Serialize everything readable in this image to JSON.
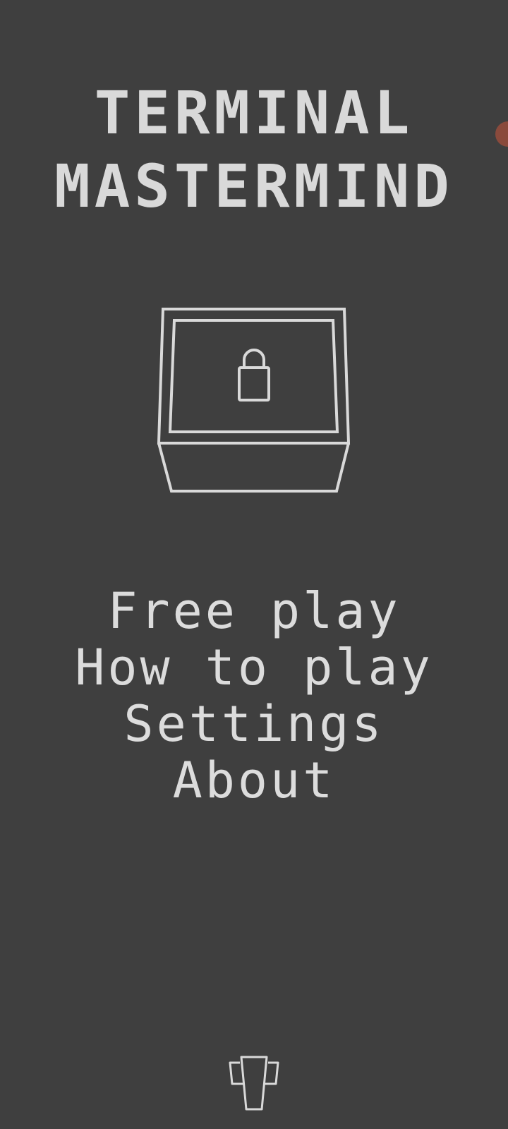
{
  "app": {
    "title_line1": "TERMINAL",
    "title_line2": "MASTERMIND"
  },
  "logo": {
    "icon": "locked-box-icon"
  },
  "menu": {
    "items": [
      {
        "label": "Free play"
      },
      {
        "label": "How to play"
      },
      {
        "label": "Settings"
      },
      {
        "label": "About"
      }
    ]
  },
  "footer": {
    "icon": "trophy-icon"
  },
  "colors": {
    "background": "#3f3f3f",
    "foreground": "#d9d9d9",
    "accent_dot": "#8a4a3c"
  }
}
